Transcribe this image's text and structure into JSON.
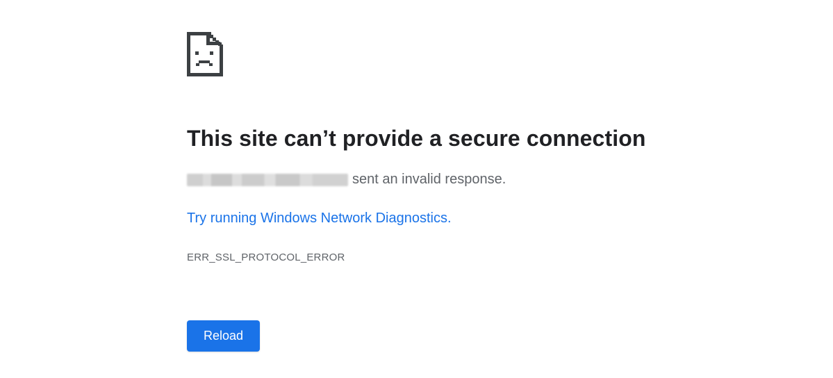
{
  "error_page": {
    "icon": "sad-page-icon",
    "title": "This site can’t provide a secure connection",
    "host_text_blurred": "",
    "subtitle_suffix": "sent an invalid response.",
    "diagnostics_link": "Try running Windows Network Diagnostics.",
    "error_code": "ERR_SSL_PROTOCOL_ERROR",
    "reload_button": "Reload"
  },
  "colors": {
    "title": "#202124",
    "secondary_text": "#5f6368",
    "link": "#1a73e8",
    "button_bg": "#1a73e8",
    "button_text": "#ffffff",
    "icon": "#3c4043"
  }
}
